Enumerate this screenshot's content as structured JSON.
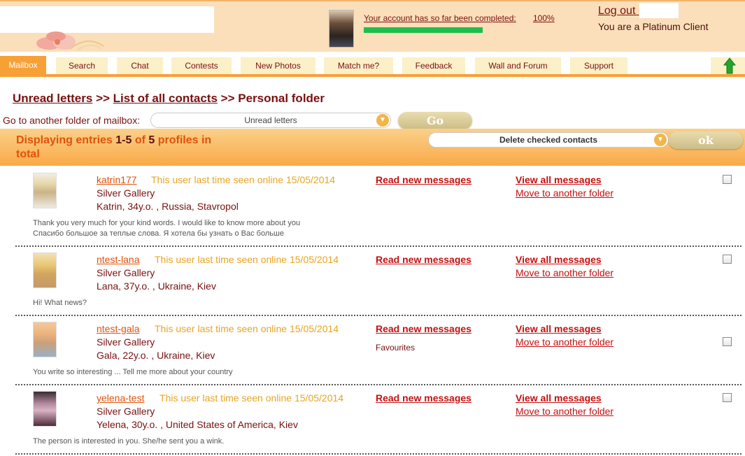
{
  "header": {
    "account_status": "Your account has so far been completed:",
    "account_percent": "100%",
    "account_progress": 1.0,
    "logout_label": "Log out (",
    "client_status": "You are a Platinum Client"
  },
  "nav": {
    "items": [
      {
        "label": "Mailbox",
        "active": true
      },
      {
        "label": "Search"
      },
      {
        "label": "Chat"
      },
      {
        "label": "Contests"
      },
      {
        "label": "New  Photos"
      },
      {
        "label": "Match me?"
      },
      {
        "label": "Feedback"
      },
      {
        "label": "Wall and Forum"
      },
      {
        "label": "Support"
      }
    ],
    "up_icon": "up-arrow-icon"
  },
  "breadcrumb": {
    "unread": "Unread letters",
    "sep1": ">>",
    "all_contacts": "List of all contacts",
    "sep2": ">>",
    "current": "Personal folder"
  },
  "folder": {
    "label": "Go to another folder of mailbox:",
    "selected": "Unread letters",
    "go_label": "Go"
  },
  "listing": {
    "prefix": "Displaying entries ",
    "range": "1-5",
    "of": " of ",
    "total": "5",
    "suffix": " profiles in total",
    "action_selected": "Delete checked contacts",
    "ok_label": "ok"
  },
  "contacts": [
    {
      "username": "katrin177",
      "last_seen": "This user last time seen online 15/05/2014",
      "gallery": "Silver Gallery",
      "info": "Katrin, 34y.o. , Russia, Stavropol",
      "message_lines": [
        "Thank you very much for your kind words. I would like to know more about you",
        "Спасибо большое за теплые слова. Я хотела бы узнать о Вас больше"
      ],
      "read_label": "Read new messages",
      "view_label": "View all messages",
      "move_label": "Move to another folder",
      "tag": ""
    },
    {
      "username": "ntest-lana",
      "last_seen": "This user last time seen online 15/05/2014",
      "gallery": "Silver Gallery",
      "info": "Lana, 37y.o. , Ukraine, Kiev",
      "message_lines": [
        "Hi! What news?"
      ],
      "read_label": "Read new messages",
      "view_label": "View all messages",
      "move_label": "Move to another folder",
      "tag": ""
    },
    {
      "username": "ntest-gala",
      "last_seen": "This user last time seen online 15/05/2014",
      "gallery": "Silver Gallery",
      "info": "Gala, 22y.o. , Ukraine, Kiev",
      "message_lines": [
        "You write so interesting ... Tell me more about your country"
      ],
      "read_label": "Read new messages",
      "view_label": "View all messages",
      "move_label": "Move to another folder",
      "tag": "Favourites"
    },
    {
      "username": "yelena-test",
      "last_seen": "This user last time seen online 15/05/2014",
      "gallery": "Silver Gallery",
      "info": "Yelena, 30y.o. , United States of America, Kiev",
      "message_lines": [
        "The person is interested in you. She/he sent you a wink."
      ],
      "read_label": "Read new messages",
      "view_label": "View all messages",
      "move_label": "Move to another folder",
      "tag": ""
    }
  ],
  "colors": {
    "accent_orange": "#f7a035",
    "header_bg": "#fbdfba",
    "link_red": "#c51010",
    "progress_green": "#1bbf4a"
  }
}
